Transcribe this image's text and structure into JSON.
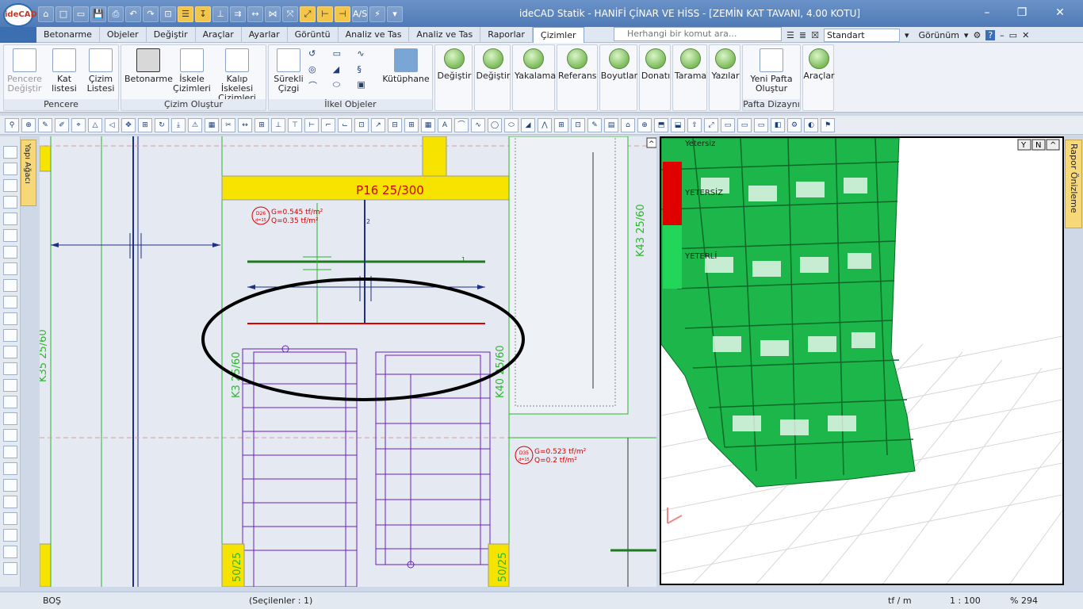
{
  "app": {
    "logo_text": "ideCAD",
    "title": "ideCAD Statik - HANİFİ ÇİNAR VE HİSS - [ZEMİN KAT TAVANI,  4.00 KOTU]",
    "window_controls": [
      "–",
      "❐",
      "✕"
    ]
  },
  "quick_access": [
    "⌂",
    "□",
    "▭",
    "💾",
    "⎙",
    "↶",
    "↷",
    "⊡",
    "☰",
    "↧",
    "⊥",
    "⇉",
    "↔",
    "⋈",
    "⤧",
    "⤢",
    "⊢",
    "⊣",
    "A/S",
    "⚡",
    "▾"
  ],
  "tabs": [
    "Betonarme",
    "Objeler",
    "Değiştir",
    "Araçlar",
    "Ayarlar",
    "Görüntü",
    "Analiz ve Tas",
    "Analiz ve Tas",
    "Raporlar",
    "Çizimler"
  ],
  "active_tab": "Çizimler",
  "search": {
    "placeholder": "Herhangi bir komut ara..."
  },
  "right_tools": {
    "style": "Standart",
    "view": "Görünüm"
  },
  "ribbon": {
    "pencere": {
      "label": "Pencere",
      "buttons": [
        "Pencere Değiştir",
        "Kat listesi",
        "Çizim Listesi"
      ]
    },
    "cizim_olustur": {
      "label": "Çizim Oluştur",
      "buttons": [
        "Betonarme",
        "İskele Çizimleri",
        "Kalıp İskelesi Çizimleri"
      ]
    },
    "ilkel": {
      "label": "İlkel Objeler",
      "buttons": [
        "Sürekli Çizgi",
        "Kütüphane"
      ]
    },
    "green": [
      "Değiştir",
      "Değiştir",
      "Yakalama",
      "Referans",
      "Boyutlar",
      "Donatı",
      "Tarama",
      "Yazılar"
    ],
    "pafta": {
      "label": "Pafta Dizaynı",
      "buttons": [
        "Yeni Pafta Oluştur"
      ]
    },
    "araclar": "Araçlar"
  },
  "side_tabs": {
    "left": "Yapı Ağacı",
    "right": "Rapor Önizleme"
  },
  "drawing": {
    "beam_label": "P16 25/300",
    "load1": {
      "g": "G=0.545 tf/m²",
      "q": "Q=0.35 tf/m²",
      "code_top": "D26",
      "code_bottom": "d=15"
    },
    "load2": {
      "g": "G=0.523 tf/m²",
      "q": "Q=0.2 tf/m²",
      "code_top": "D35",
      "code_bottom": "d=15"
    },
    "beams": [
      "K43 25/60",
      "K3 25/60",
      "K40 25/60",
      "K35 25/60"
    ],
    "bottom_beams": [
      "50/25",
      "50/25"
    ],
    "dim_labels": [
      "1",
      "2"
    ]
  },
  "viewer": {
    "labels": [
      "Yetersiz",
      "YETERSİZ",
      "YETERLİ"
    ],
    "corner_buttons": [
      "Y",
      "N",
      "^"
    ]
  },
  "status": {
    "left": "BOŞ",
    "selected": "(Seçilenler : 1)",
    "unit": "tf / m",
    "scale": "1 : 100",
    "zoom": "% 294"
  }
}
